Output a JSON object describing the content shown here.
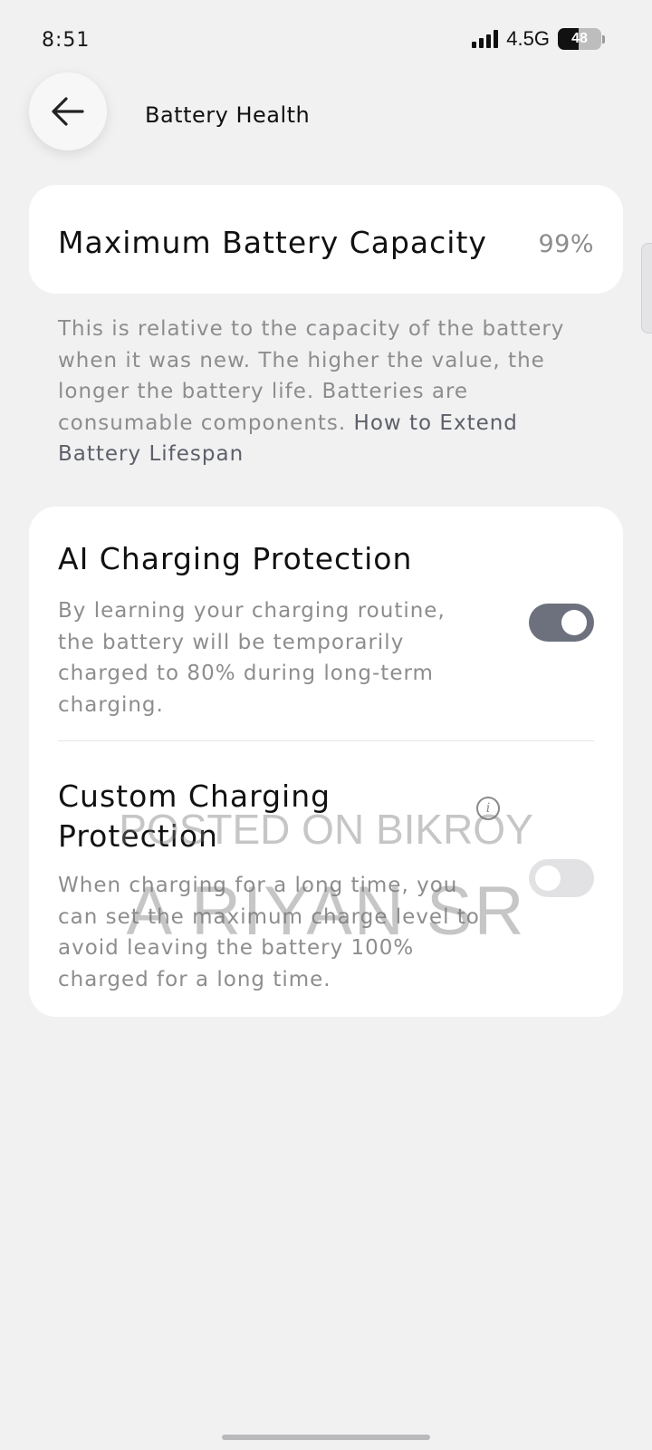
{
  "status_bar": {
    "time": "8:51",
    "network": "4.5G",
    "battery_level": "48",
    "battery_fraction": 0.48,
    "signal_bars": 4
  },
  "header": {
    "back_icon": "arrow-left-icon",
    "title": "Battery Health"
  },
  "capacity": {
    "label": "Maximum Battery Capacity",
    "value": "99%",
    "description": "This is relative to the capacity of the battery when it was new. The higher the value, the longer the battery life. Batteries are consumable components.",
    "link": "How to Extend Battery Lifespan"
  },
  "ai_protection": {
    "title": "AI Charging Protection",
    "description": "By learning your charging routine, the battery will be temporarily charged to 80% during long-term charging.",
    "enabled": true
  },
  "custom_protection": {
    "title": "Custom Charging Protection",
    "info_icon": "info-icon",
    "description": "When charging for a long time, you can set the maximum charge level to avoid leaving the battery 100% charged for a long time.",
    "enabled": false
  },
  "watermark": {
    "line1": "POSTED ON BIKROY",
    "line2": "A RIYAN SR"
  },
  "colors": {
    "background": "#f1f1f2",
    "card": "#ffffff",
    "toggle_on": "#6c717d",
    "toggle_off": "#e2e2e4",
    "secondary_text": "#8d8d8f"
  }
}
